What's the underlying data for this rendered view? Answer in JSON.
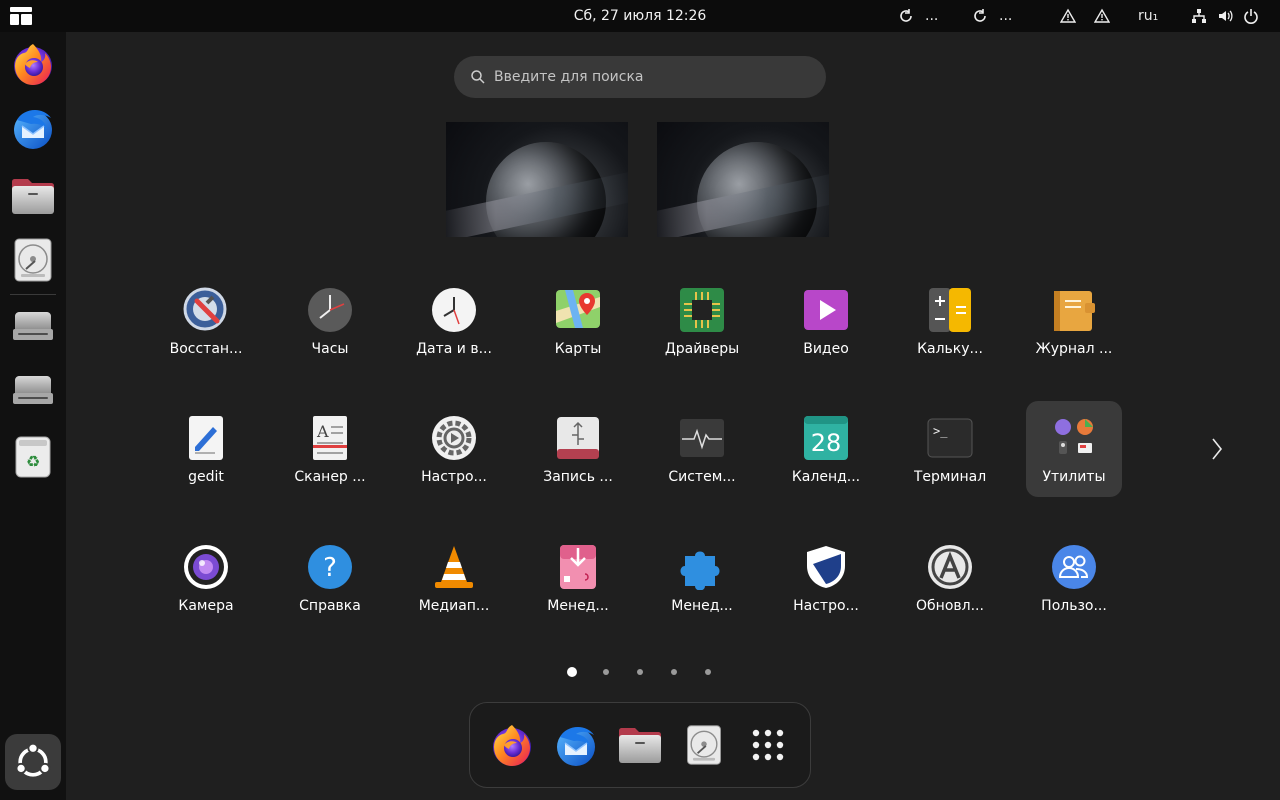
{
  "topbar": {
    "clock": "Сб, 27 июля  12:26",
    "tray": {
      "refresh_1_label": "...",
      "refresh_2_label": "...",
      "keyboard_layout": "ru₁"
    }
  },
  "search": {
    "placeholder": "Введите для поиска"
  },
  "dock": {
    "items": [
      "firefox-icon",
      "thunderbird-icon",
      "files-icon",
      "disk-image-icon",
      "drive-icon",
      "drive-icon",
      "trash-icon"
    ],
    "show_apps": "ubuntu-logo-icon"
  },
  "apps": {
    "row1": [
      {
        "label": "Восстан...",
        "icon": "backup-icon"
      },
      {
        "label": "Часы",
        "icon": "clock-icon"
      },
      {
        "label": "Дата и в...",
        "icon": "datetime-icon"
      },
      {
        "label": "Карты",
        "icon": "maps-icon"
      },
      {
        "label": "Драйверы",
        "icon": "chip-icon"
      },
      {
        "label": "Видео",
        "icon": "video-icon"
      },
      {
        "label": "Кальку...",
        "icon": "calculator-icon"
      },
      {
        "label": "Журнал ...",
        "icon": "log-journal-icon"
      }
    ],
    "row2": [
      {
        "label": "gedit",
        "icon": "text-editor-icon"
      },
      {
        "label": "Сканер ...",
        "icon": "scanner-icon"
      },
      {
        "label": "Настро...",
        "icon": "settings-gear-icon"
      },
      {
        "label": "Запись ...",
        "icon": "usb-writer-icon"
      },
      {
        "label": "Систем...",
        "icon": "system-monitor-icon"
      },
      {
        "label": "Календ...",
        "icon": "calendar-icon",
        "day": "28"
      },
      {
        "label": "Терминал",
        "icon": "terminal-icon",
        "prompt": ">_"
      },
      {
        "label": "Утилиты",
        "icon": "utilities-folder-icon"
      }
    ],
    "row3": [
      {
        "label": "Камера",
        "icon": "camera-icon"
      },
      {
        "label": "Справка",
        "icon": "help-icon",
        "glyph": "?"
      },
      {
        "label": "Медиап...",
        "icon": "vlc-icon"
      },
      {
        "label": "Менед...",
        "icon": "package-installer-icon"
      },
      {
        "label": "Менед...",
        "icon": "extensions-icon"
      },
      {
        "label": "Настро...",
        "icon": "security-shield-icon"
      },
      {
        "label": "Обновл...",
        "icon": "software-updater-icon"
      },
      {
        "label": "Пользо...",
        "icon": "users-icon"
      }
    ]
  },
  "pagination": {
    "pages": 5,
    "current": 1
  },
  "dash": {
    "items": [
      "firefox-icon",
      "thunderbird-icon",
      "files-icon",
      "disk-image-icon",
      "app-grid-icon"
    ]
  },
  "colors": {
    "background": "#1f1f1f",
    "topbar": "#0c0c0c",
    "dock": "#111111",
    "search": "#393939",
    "selected_tile": "#3a3a3a"
  }
}
